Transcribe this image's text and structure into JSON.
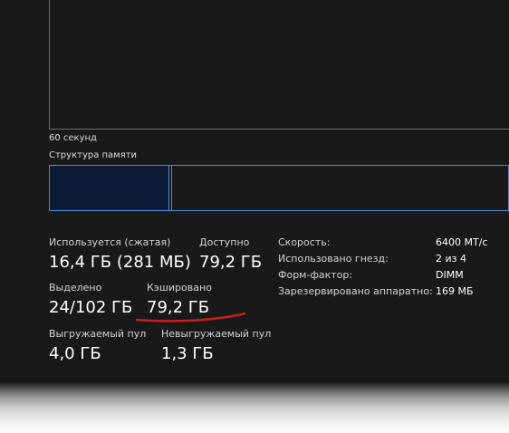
{
  "graph": {
    "time_label": "60 секунд"
  },
  "composition": {
    "title": "Структура памяти",
    "in_use_fraction": 0.26
  },
  "stats": {
    "in_use": {
      "label": "Используется (сжатая)",
      "value": "16,4 ГБ (281 МБ)"
    },
    "available": {
      "label": "Доступно",
      "value": "79,2 ГБ"
    },
    "committed": {
      "label": "Выделено",
      "value": "24/102 ГБ"
    },
    "cached": {
      "label": "Кэшировано",
      "value": "79,2 ГБ"
    },
    "paged_pool": {
      "label": "Выгружаемый пул",
      "value": "4,0 ГБ"
    },
    "non_paged_pool": {
      "label": "Невыгружаемый пул",
      "value": "1,3 ГБ"
    }
  },
  "details": [
    {
      "key": "Скорость:",
      "value": "6400 МТ/с"
    },
    {
      "key": "Использовано гнезд:",
      "value": "2 из 4"
    },
    {
      "key": "Форм-фактор:",
      "value": "DIMM"
    },
    {
      "key": "Зарезервировано аппаратно:",
      "value": "169 МБ"
    }
  ],
  "colors": {
    "background": "#191919",
    "graph_border": "#6c6c6c",
    "composition_border": "#4a8fd6",
    "in_use_fill": "#0d1b36",
    "annotation": "#c8201c"
  }
}
